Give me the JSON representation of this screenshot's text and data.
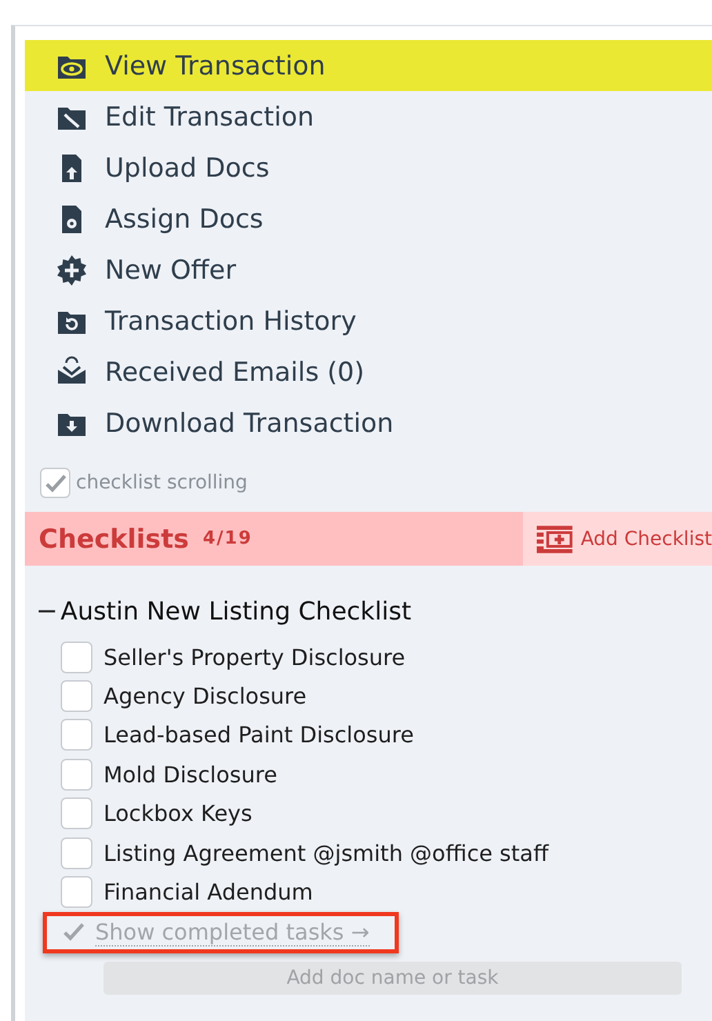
{
  "nav": [
    {
      "label": "View Transaction",
      "selected": true
    },
    {
      "label": "Edit Transaction",
      "selected": false
    },
    {
      "label": "Upload Docs",
      "selected": false
    },
    {
      "label": "Assign Docs",
      "selected": false
    },
    {
      "label": "New Offer",
      "selected": false
    },
    {
      "label": "Transaction History",
      "selected": false
    },
    {
      "label": "Received Emails (0)",
      "selected": false
    },
    {
      "label": "Download Transaction",
      "selected": false
    }
  ],
  "scrolling_option": {
    "label": "checklist scrolling",
    "checked": true
  },
  "checklists_header": {
    "title": "Checklists",
    "count": "4/19",
    "add_button": "Add Checklist"
  },
  "checklist": {
    "toggle": "−",
    "title": "Austin New Listing Checklist",
    "expanded": true,
    "tasks": [
      {
        "label": "Seller's Property Disclosure",
        "checked": false
      },
      {
        "label": "Agency Disclosure",
        "checked": false
      },
      {
        "label": "Lead-based Paint Disclosure",
        "checked": false
      },
      {
        "label": "Mold Disclosure",
        "checked": false
      },
      {
        "label": "Lockbox Keys",
        "checked": false
      },
      {
        "label": "Listing Agreement @jsmith @office staff",
        "checked": false
      },
      {
        "label": "Financial Adendum",
        "checked": false
      }
    ],
    "show_completed": {
      "label": "Show completed tasks →",
      "highlighted": true
    },
    "add_field": {
      "placeholder": "Add doc name or task"
    }
  }
}
